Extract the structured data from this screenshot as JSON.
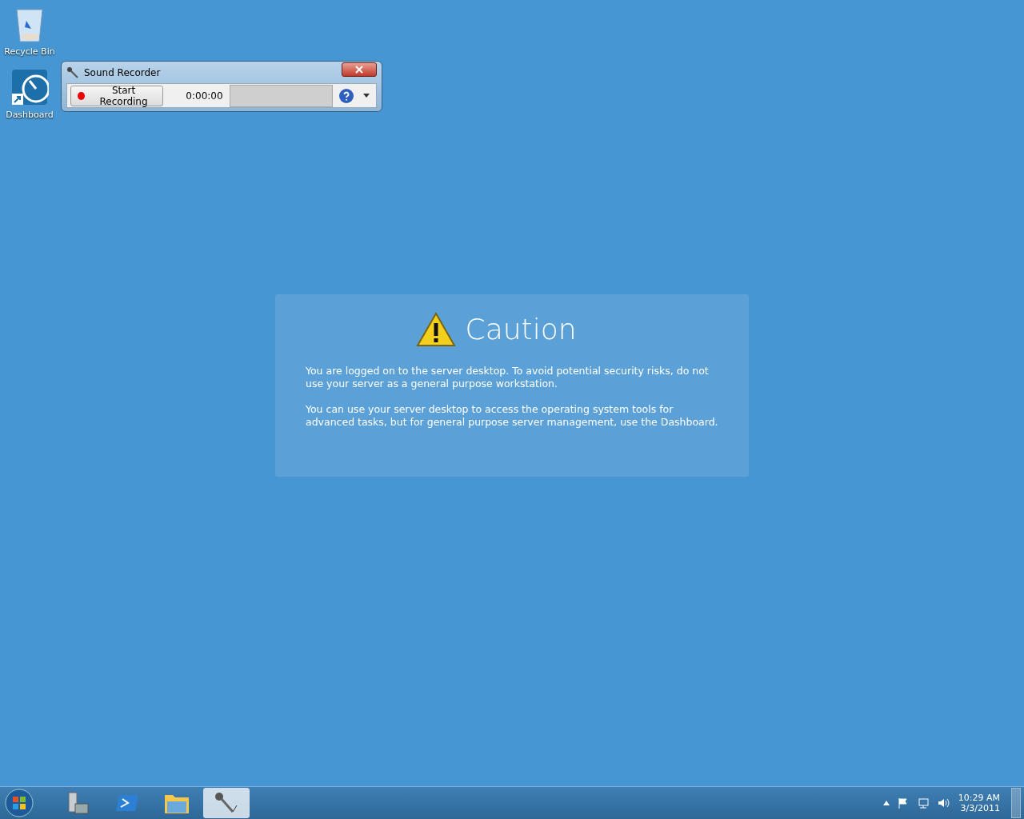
{
  "desktop_icons": [
    {
      "kind": "recycle",
      "label": "Recycle Bin"
    },
    {
      "kind": "dashboard",
      "label": "Dashboard"
    }
  ],
  "recorder": {
    "title": "Sound Recorder",
    "start_button": "Start Recording",
    "time": "0:00:00"
  },
  "caution": {
    "title": "Caution",
    "paragraphs": [
      "You are logged on to the server desktop. To avoid potential security risks, do not use your server as a general purpose workstation.",
      "You can use your server desktop to access the operating system tools for advanced tasks, but for general purpose server management, use the Dashboard."
    ]
  },
  "taskbar": {
    "items": [
      {
        "kind": "server",
        "selected": false
      },
      {
        "kind": "shell",
        "selected": false
      },
      {
        "kind": "folder",
        "selected": false
      },
      {
        "kind": "mic",
        "selected": true
      }
    ],
    "clock": {
      "time": "10:29 AM",
      "date": "3/3/2011"
    }
  }
}
